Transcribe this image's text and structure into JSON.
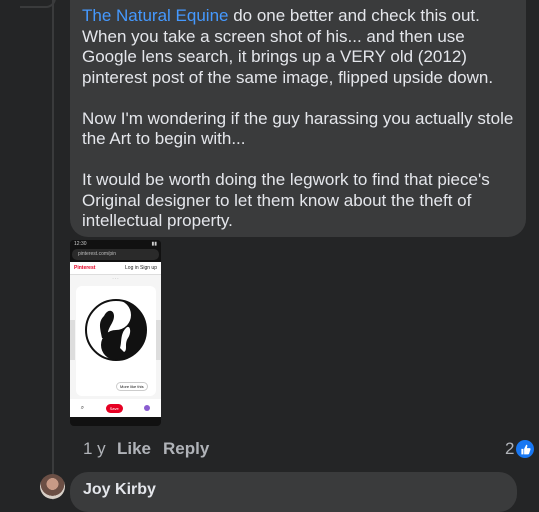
{
  "comment": {
    "mention": "The Natural Equine",
    "line1_rest": " do one better and check this out. When you take a screen shot of his...  and then use Google lens search, it brings up a VERY old (2012) pinterest post of the same image, flipped upside down.",
    "para2": "Now I'm wondering if the guy harassing you actually stole the Art to begin with...",
    "para3": "It would be worth doing the legwork to find that piece's Original designer to let them know about the theft of intellectual property."
  },
  "attachment": {
    "url": "pinterest.com/pin",
    "site": "Pinterest",
    "login": "Log in",
    "signup": "Sign up",
    "more_like": "More like this",
    "save": "Save"
  },
  "actions": {
    "time": "1 y",
    "like": "Like",
    "reply": "Reply",
    "reaction_count": "2"
  },
  "next_comment": {
    "author": "Joy Kirby"
  },
  "colors": {
    "background": "#242526",
    "bubble": "#3a3b3c",
    "mention": "#4599ff",
    "like": "#1877f2"
  }
}
